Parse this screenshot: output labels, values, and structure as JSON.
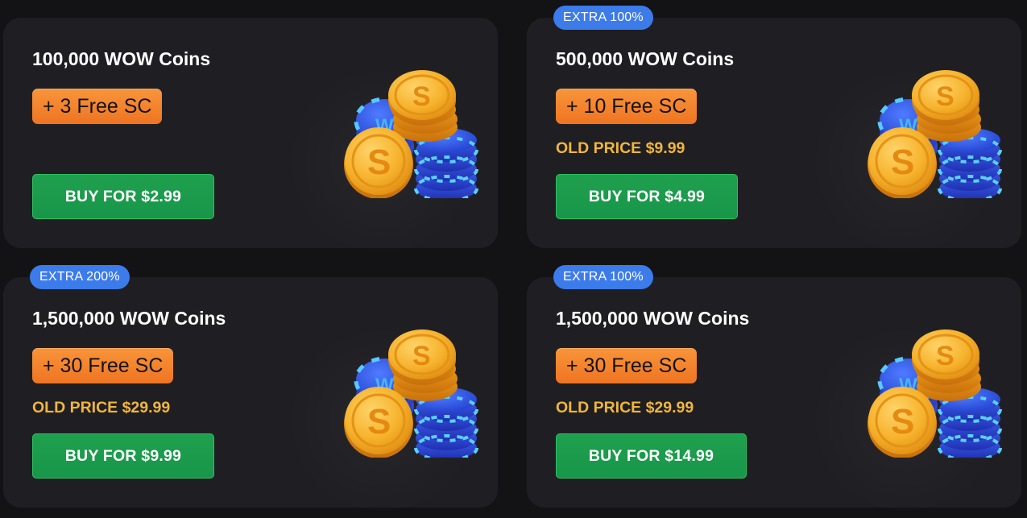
{
  "colors": {
    "page_background": "#131316",
    "card_background": "#1f1f23",
    "extra_badge": "#3c7bea",
    "free_badge": "#f38a30",
    "old_price": "#f0b63c",
    "buy_button": "#1ea14e",
    "coin_gold": "#f5b12d",
    "chip_blue": "#2d4fd8"
  },
  "packages": [
    {
      "extra_badge": "",
      "coins_title": "100,000 WOW Coins",
      "free_sc": "+ 3 Free SC",
      "old_price": "",
      "buy_label": "BUY FOR $2.99",
      "coin_icon": "coin-stack-icon"
    },
    {
      "extra_badge": "EXTRA 100%",
      "coins_title": "500,000 WOW Coins",
      "free_sc": "+ 10 Free SC",
      "old_price": "OLD PRICE $9.99",
      "buy_label": "BUY FOR $4.99",
      "coin_icon": "coin-stack-icon"
    },
    {
      "extra_badge": "EXTRA 200%",
      "coins_title": "1,500,000 WOW Coins",
      "free_sc": "+ 30 Free SC",
      "old_price": "OLD PRICE $29.99",
      "buy_label": "BUY FOR $9.99",
      "coin_icon": "coin-stack-icon"
    },
    {
      "extra_badge": "EXTRA 100%",
      "coins_title": "1,500,000 WOW Coins",
      "free_sc": "+ 30 Free SC",
      "old_price": "OLD PRICE $29.99",
      "buy_label": "BUY FOR $14.99",
      "coin_icon": "coin-stack-icon"
    }
  ]
}
